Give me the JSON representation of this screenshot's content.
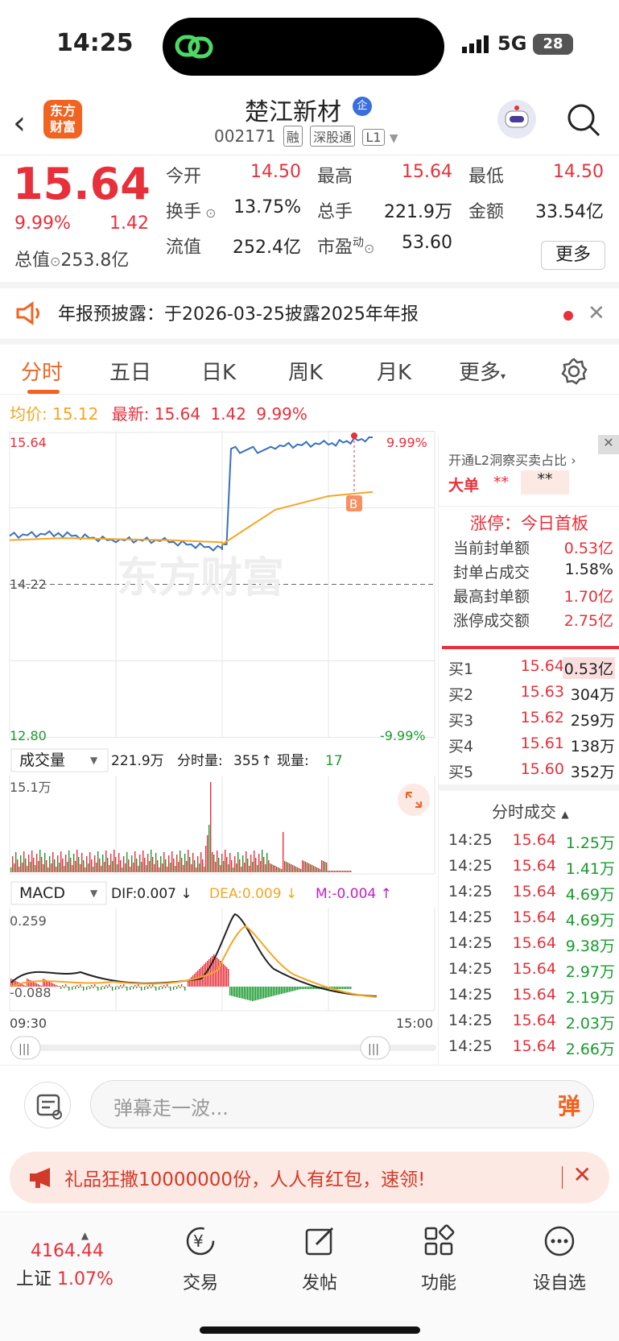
{
  "status": {
    "time": "14:25",
    "network": "5G",
    "battery": "28"
  },
  "header": {
    "stock_name": "楚江新材",
    "badge": "企",
    "code": "002171",
    "tags": [
      "融",
      "深股通",
      "L1"
    ],
    "logo_line1": "东方",
    "logo_line2": "财富"
  },
  "quote": {
    "price": "15.64",
    "pct": "9.99%",
    "change": "1.42",
    "items": [
      {
        "label": "今开",
        "value": "14.50",
        "color": "red"
      },
      {
        "label": "最高",
        "value": "15.64",
        "color": "red"
      },
      {
        "label": "最低",
        "value": "14.50",
        "color": "red"
      },
      {
        "label": "换手",
        "value": "13.75%",
        "color": "dark"
      },
      {
        "label": "总手",
        "value": "221.9万",
        "color": "dark"
      },
      {
        "label": "金额",
        "value": "33.54亿",
        "color": "dark"
      },
      {
        "label": "流值",
        "value": "252.4亿",
        "color": "dark"
      },
      {
        "label": "市盈",
        "value": "53.60",
        "color": "dark"
      }
    ],
    "total_mcap_label": "总值",
    "total_mcap": "253.8亿",
    "pe_sup": "动",
    "more": "更多"
  },
  "notice": "年报预披露：于2026-03-25披露2025年年报",
  "tabs": [
    "分时",
    "五日",
    "日K",
    "周K",
    "月K",
    "更多"
  ],
  "avgline": {
    "avg_label": "均价:",
    "avg": "15.12",
    "latest_label": "最新:",
    "latest": "15.64",
    "chg": "1.42",
    "pct": "9.99%"
  },
  "chart_axes": {
    "top": "15.64",
    "mid": "14.22",
    "bottom": "12.80",
    "top_pct": "9.99%",
    "bottom_pct": "-9.99%",
    "vol_max": "15.1万",
    "macd_max": "0.259",
    "macd_min": "-0.088",
    "start": "09:30",
    "end": "15:00",
    "watermark": "东方财富",
    "marker": "B"
  },
  "volume_bar": {
    "selector": "成交量",
    "total": "221.9万",
    "fs_label": "分时量:",
    "fs": "355",
    "now_label": "现量:",
    "now": "17"
  },
  "macd_bar": {
    "selector": "MACD",
    "dif": "DIF:0.007",
    "dea": "DEA:0.009",
    "m": "M:-0.004"
  },
  "right_panel": {
    "l2": "开通L2洞察买卖占比",
    "big_order_label": "大单",
    "big_order_a": "**",
    "big_order_b": "**",
    "limit_title": "涨停：今日首板",
    "limit_rows": [
      {
        "label": "当前封单额",
        "value": "0.53亿"
      },
      {
        "label": "封单占成交",
        "value": "1.58%"
      },
      {
        "label": "最高封单额",
        "value": "1.70亿"
      },
      {
        "label": "涨停成交额",
        "value": "2.75亿"
      }
    ],
    "orderbook": [
      {
        "label": "买1",
        "price": "15.64",
        "vol": "0.53亿"
      },
      {
        "label": "买2",
        "price": "15.63",
        "vol": "304万"
      },
      {
        "label": "买3",
        "price": "15.62",
        "vol": "259万"
      },
      {
        "label": "买4",
        "price": "15.61",
        "vol": "138万"
      },
      {
        "label": "买5",
        "price": "15.60",
        "vol": "352万"
      }
    ],
    "trades_title": "分时成交",
    "trades": [
      {
        "t": "14:25",
        "p": "15.64",
        "v": "1.25万"
      },
      {
        "t": "14:25",
        "p": "15.64",
        "v": "1.41万"
      },
      {
        "t": "14:25",
        "p": "15.64",
        "v": "4.69万"
      },
      {
        "t": "14:25",
        "p": "15.64",
        "v": "4.69万"
      },
      {
        "t": "14:25",
        "p": "15.64",
        "v": "9.38万"
      },
      {
        "t": "14:25",
        "p": "15.64",
        "v": "2.97万"
      },
      {
        "t": "14:25",
        "p": "15.64",
        "v": "2.19万"
      },
      {
        "t": "14:25",
        "p": "15.64",
        "v": "2.03万"
      },
      {
        "t": "14:25",
        "p": "15.64",
        "v": "2.66万"
      }
    ]
  },
  "comment": {
    "placeholder": "弹幕走一波...",
    "dan": "弹"
  },
  "promo": "礼品狂撒10000000份，人人有红包，速领!",
  "bottom_nav": {
    "index_value": "4164.44",
    "index_name": "上证",
    "index_pct": "1.07%",
    "items": [
      "交易",
      "发帖",
      "功能",
      "设自选"
    ]
  },
  "colors": {
    "up": "#e8303a",
    "down": "#1a9a2e",
    "accent": "#f26322",
    "avg": "#f5a623",
    "price_line": "#3a6fbf"
  },
  "chart_data": {
    "type": "line",
    "series": [
      {
        "name": "price",
        "x": [
          "09:30",
          "10:00",
          "10:30",
          "11:00",
          "11:30",
          "13:00",
          "13:30",
          "14:00",
          "14:25"
        ],
        "y": [
          14.7,
          14.72,
          14.66,
          14.65,
          14.58,
          14.62,
          15.55,
          15.58,
          15.64
        ]
      },
      {
        "name": "avg",
        "x": [
          "09:30",
          "10:00",
          "10:30",
          "11:00",
          "11:30",
          "13:00",
          "13:30",
          "14:00",
          "14:25"
        ],
        "y": [
          14.66,
          14.68,
          14.67,
          14.66,
          14.64,
          14.62,
          14.95,
          15.08,
          15.12
        ]
      }
    ],
    "ylim": [
      12.8,
      15.64
    ]
  }
}
